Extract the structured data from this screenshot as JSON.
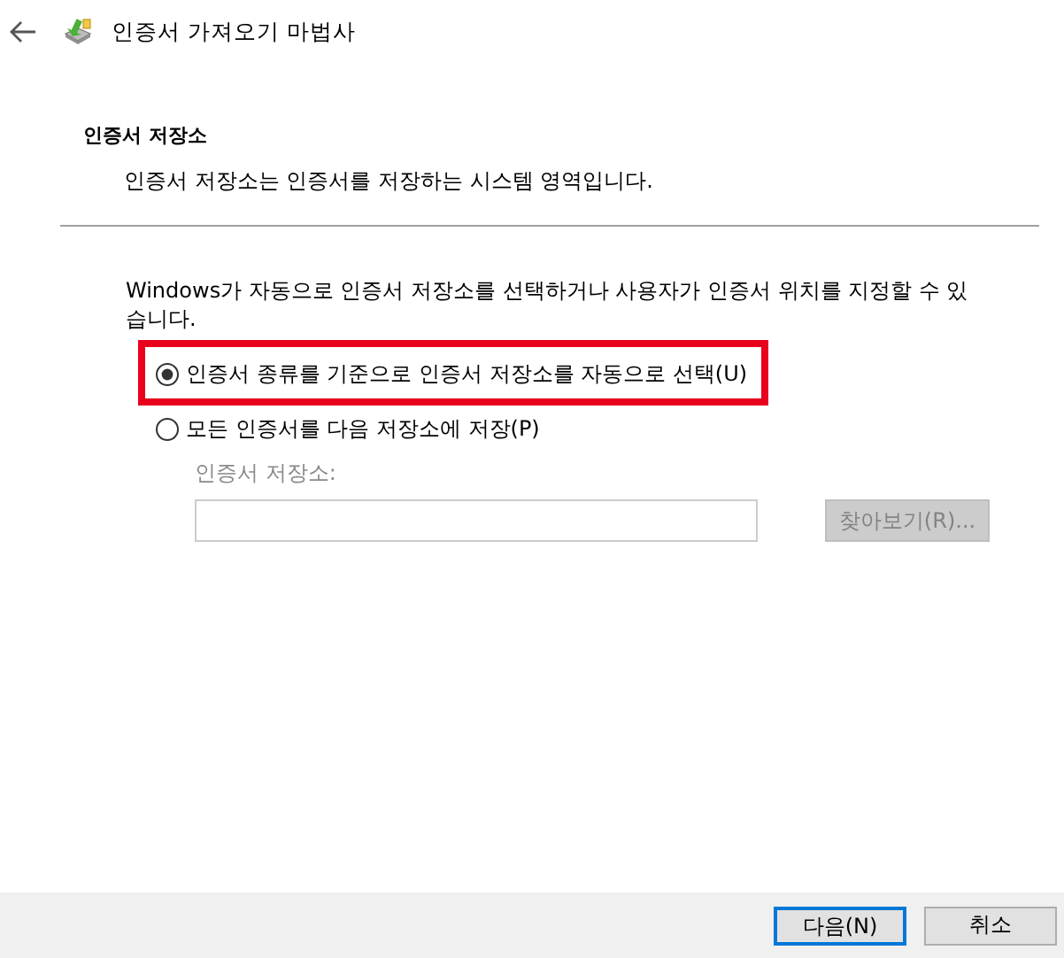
{
  "window": {
    "title": "인증서 가져오기 마법사"
  },
  "section": {
    "heading": "인증서 저장소",
    "description": "인증서 저장소는 인증서를 저장하는 시스템 영역입니다."
  },
  "instructions": "Windows가 자동으로 인증서 저장소를 선택하거나 사용자가 인증서 위치를 지정할 수 있습니다.",
  "options": [
    {
      "label": "인증서 종류를 기준으로 인증서 저장소를 자동으로 선택(U)",
      "selected": true,
      "highlighted": true
    },
    {
      "label": "모든 인증서를 다음 저장소에 저장(P)",
      "selected": false,
      "highlighted": false
    }
  ],
  "store": {
    "label": "인증서 저장소:",
    "disabled": true,
    "browse_button": "찾아보기(R)..."
  },
  "buttons": [
    {
      "label": "다음(N)",
      "default": true
    },
    {
      "label": "취소",
      "default": false
    }
  ]
}
